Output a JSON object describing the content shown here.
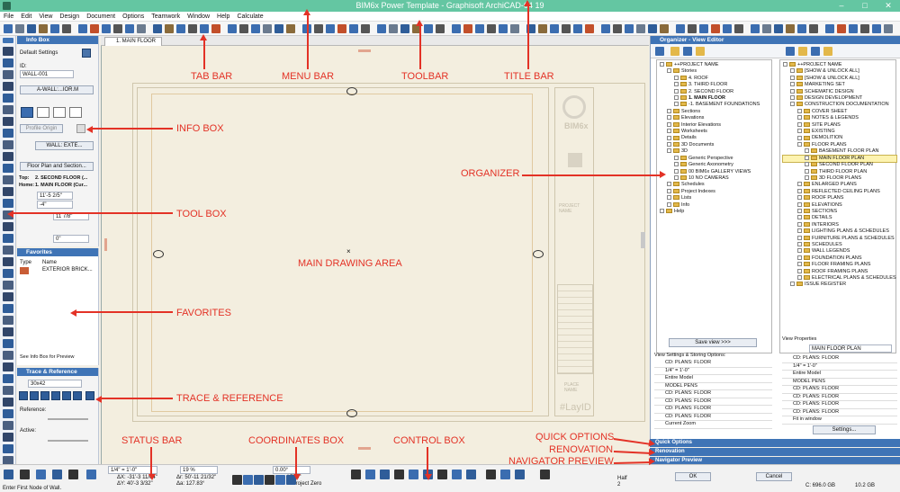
{
  "window": {
    "title": "BIM6x Power Template - Graphisoft ArchiCAD-64 19",
    "minimize": "–",
    "maximize": "□",
    "close": "✕"
  },
  "menu": {
    "items": [
      "File",
      "Edit",
      "View",
      "Design",
      "Document",
      "Options",
      "Teamwork",
      "Window",
      "Help",
      "Calculate"
    ]
  },
  "tab": {
    "label": "1. MAIN FLOOR"
  },
  "infobox": {
    "header": "Info Box",
    "default_settings": "Default Settings",
    "id_label": "ID:",
    "id_value": "WALL-001",
    "composite": "A-WALL:...IOR.M",
    "profile_origin": "Profile Origin",
    "layer": "WALL: EXTE...",
    "floorplan_btn": "Floor Plan and Section...",
    "top_label": "Top:",
    "top_value": "2. SECOND FLOOR (...",
    "home_label": "Home:",
    "home_value": "1. MAIN FLOOR (Cur...",
    "h1": "11'-5 2/5\"",
    "h2": "-4\"",
    "thickness": "11 7/8\"",
    "angle": "0\""
  },
  "favorites": {
    "header": "Favorites",
    "col_type": "Type",
    "col_name": "Name",
    "item": "EXTERIOR BRICK...",
    "footer": "See Info Box for Preview"
  },
  "trace": {
    "header": "Trace & Reference",
    "value": "30x42",
    "reference_label": "Reference:",
    "active_label": "Active:"
  },
  "drawing": {
    "title_block_text": "PROJECT NAME",
    "title_block_text2": "PLACE NAME",
    "layout_id": "#LayID",
    "logo": "BIM6x"
  },
  "organizer": {
    "header": "Organizer - View Editor",
    "left_tree": [
      {
        "label": "++PROJECT NAME",
        "indent": 0
      },
      {
        "label": "Stories",
        "indent": 1
      },
      {
        "label": "4. ROOF",
        "indent": 2
      },
      {
        "label": "3. THIRD FLOOR",
        "indent": 2
      },
      {
        "label": "2. SECOND FLOOR",
        "indent": 2
      },
      {
        "label": "1. MAIN FLOOR",
        "indent": 2,
        "bold": true
      },
      {
        "label": "-1. BASEMENT FOUNDATIONS",
        "indent": 2
      },
      {
        "label": "Sections",
        "indent": 1
      },
      {
        "label": "Elevations",
        "indent": 1
      },
      {
        "label": "Interior Elevations",
        "indent": 1
      },
      {
        "label": "Worksheets",
        "indent": 1
      },
      {
        "label": "Details",
        "indent": 1
      },
      {
        "label": "3D Documents",
        "indent": 1
      },
      {
        "label": "3D",
        "indent": 1
      },
      {
        "label": "Generic Perspective",
        "indent": 2
      },
      {
        "label": "Generic Axonometry",
        "indent": 2
      },
      {
        "label": "00 BIM6x GALLERY VIEWS",
        "indent": 2
      },
      {
        "label": "10 NO CAMERAS",
        "indent": 2
      },
      {
        "label": "Schedules",
        "indent": 1
      },
      {
        "label": "Project Indexes",
        "indent": 1
      },
      {
        "label": "Lists",
        "indent": 1
      },
      {
        "label": "Info",
        "indent": 1
      },
      {
        "label": "Help",
        "indent": 0
      }
    ],
    "right_tree": [
      {
        "label": "++PROJECT NAME",
        "indent": 0
      },
      {
        "label": "[SHOW & UNLOCK ALL]",
        "indent": 1
      },
      {
        "label": "[SHOW & UNLOCK ALL]",
        "indent": 1
      },
      {
        "label": "MARKETING SET",
        "indent": 1
      },
      {
        "label": "SCHEMATIC DESIGN",
        "indent": 1
      },
      {
        "label": "DESIGN DEVELOPMENT",
        "indent": 1
      },
      {
        "label": "CONSTRUCTION DOCUMENTATION",
        "indent": 1
      },
      {
        "label": "COVER SHEET",
        "indent": 2
      },
      {
        "label": "NOTES & LEGENDS",
        "indent": 2
      },
      {
        "label": "SITE PLANS",
        "indent": 2
      },
      {
        "label": "EXISTING",
        "indent": 2
      },
      {
        "label": "DEMOLITION",
        "indent": 2
      },
      {
        "label": "FLOOR PLANS",
        "indent": 2
      },
      {
        "label": "BASEMENT FLOOR PLAN",
        "indent": 3
      },
      {
        "label": "MAIN FLOOR PLAN",
        "indent": 3,
        "selected": true
      },
      {
        "label": "SECOND FLOOR PLAN",
        "indent": 3
      },
      {
        "label": "THIRD FLOOR PLAN",
        "indent": 3
      },
      {
        "label": "3D FLOOR PLANS",
        "indent": 3
      },
      {
        "label": "ENLARGED PLANS",
        "indent": 2
      },
      {
        "label": "REFLECTED CEILING PLANS",
        "indent": 2
      },
      {
        "label": "ROOF PLANS",
        "indent": 2
      },
      {
        "label": "ELEVATIONS",
        "indent": 2
      },
      {
        "label": "SECTIONS",
        "indent": 2
      },
      {
        "label": "DETAILS",
        "indent": 2
      },
      {
        "label": "INTERIORS",
        "indent": 2
      },
      {
        "label": "LIGHTING PLANS & SCHEDULES",
        "indent": 2
      },
      {
        "label": "FURNITURE PLANS & SCHEDULES",
        "indent": 2
      },
      {
        "label": "SCHEDULES",
        "indent": 2
      },
      {
        "label": "WALL LEGENDS",
        "indent": 2
      },
      {
        "label": "FOUNDATION PLANS",
        "indent": 2
      },
      {
        "label": "FLOOR FRAMING PLANS",
        "indent": 2
      },
      {
        "label": "ROOF FRAMING PLANS",
        "indent": 2
      },
      {
        "label": "ELECTRICAL PLANS & SCHEDULES",
        "indent": 2
      },
      {
        "label": "ISSUE REGISTER",
        "indent": 1
      }
    ],
    "save_view": "Save view >>>",
    "view_settings_label": "View Settings & Storing Options:",
    "left_settings": [
      "CD: PLANS: FLOOR",
      "1/4\"   =   1'-0\"",
      "Entire Model",
      "MODEL PENS",
      "CD: PLANS: FLOOR",
      "CD: PLANS: FLOOR",
      "CD: PLANS: FLOOR",
      "CD: PLANS: FLOOR",
      "Current Zoom"
    ],
    "view_properties": "View Properties",
    "view_name": "MAIN FLOOR PLAN",
    "right_settings": [
      "CD: PLANS: FLOOR",
      "1/4\"   =   1'-0\"",
      "Entire Model",
      "MODEL PENS",
      "CD: PLANS: FLOOR",
      "CD: PLANS: FLOOR",
      "CD: PLANS: FLOOR",
      "CD: PLANS: FLOOR",
      "Fit in window"
    ],
    "settings_btn": "Settings...",
    "quick_options": "Quick Options",
    "renovation": "Renovation",
    "navigator_preview": "Navigator Preview",
    "ok": "OK",
    "cancel": "Cancel"
  },
  "status": {
    "prompt": "Enter First Node of Wall.",
    "scale": "1/4\"   =   1'-0\"",
    "zoom": "19 %",
    "angle_field": "0.00°",
    "dx": "ΔX: -31'-3 11/64\"",
    "dy": "ΔY: 40'-3 3/32\"",
    "dr": "Δr: 50'-11 21/32\"",
    "da": "Δa: 127.83°",
    "coord_z": "ΔZ: 0\"",
    "to_project_zero": "to Project Zero",
    "half": "Half",
    "half_val": "2",
    "disk": "C: 696.0 GB",
    "mem": "10.2 GB"
  },
  "annotations": {
    "tab_bar": "TAB BAR",
    "menu_bar": "MENU BAR",
    "toolbar": "TOOLBAR",
    "title_bar": "TITLE BAR",
    "info_box": "INFO BOX",
    "organizer": "ORGANIZER",
    "tool_box": "TOOL BOX",
    "main_drawing_area": "MAIN DRAWING AREA",
    "favorites": "FAVORITES",
    "trace_reference": "TRACE & REFERENCE",
    "status_bar": "STATUS BAR",
    "coordinates_box": "COORDINATES BOX",
    "control_box": "CONTROL BOX",
    "quick_options": "QUICK OPTIONS",
    "renovation": "RENOVATION",
    "navigator_preview": "NAVIGATOR PREVIEW",
    "color": "#e33226"
  }
}
